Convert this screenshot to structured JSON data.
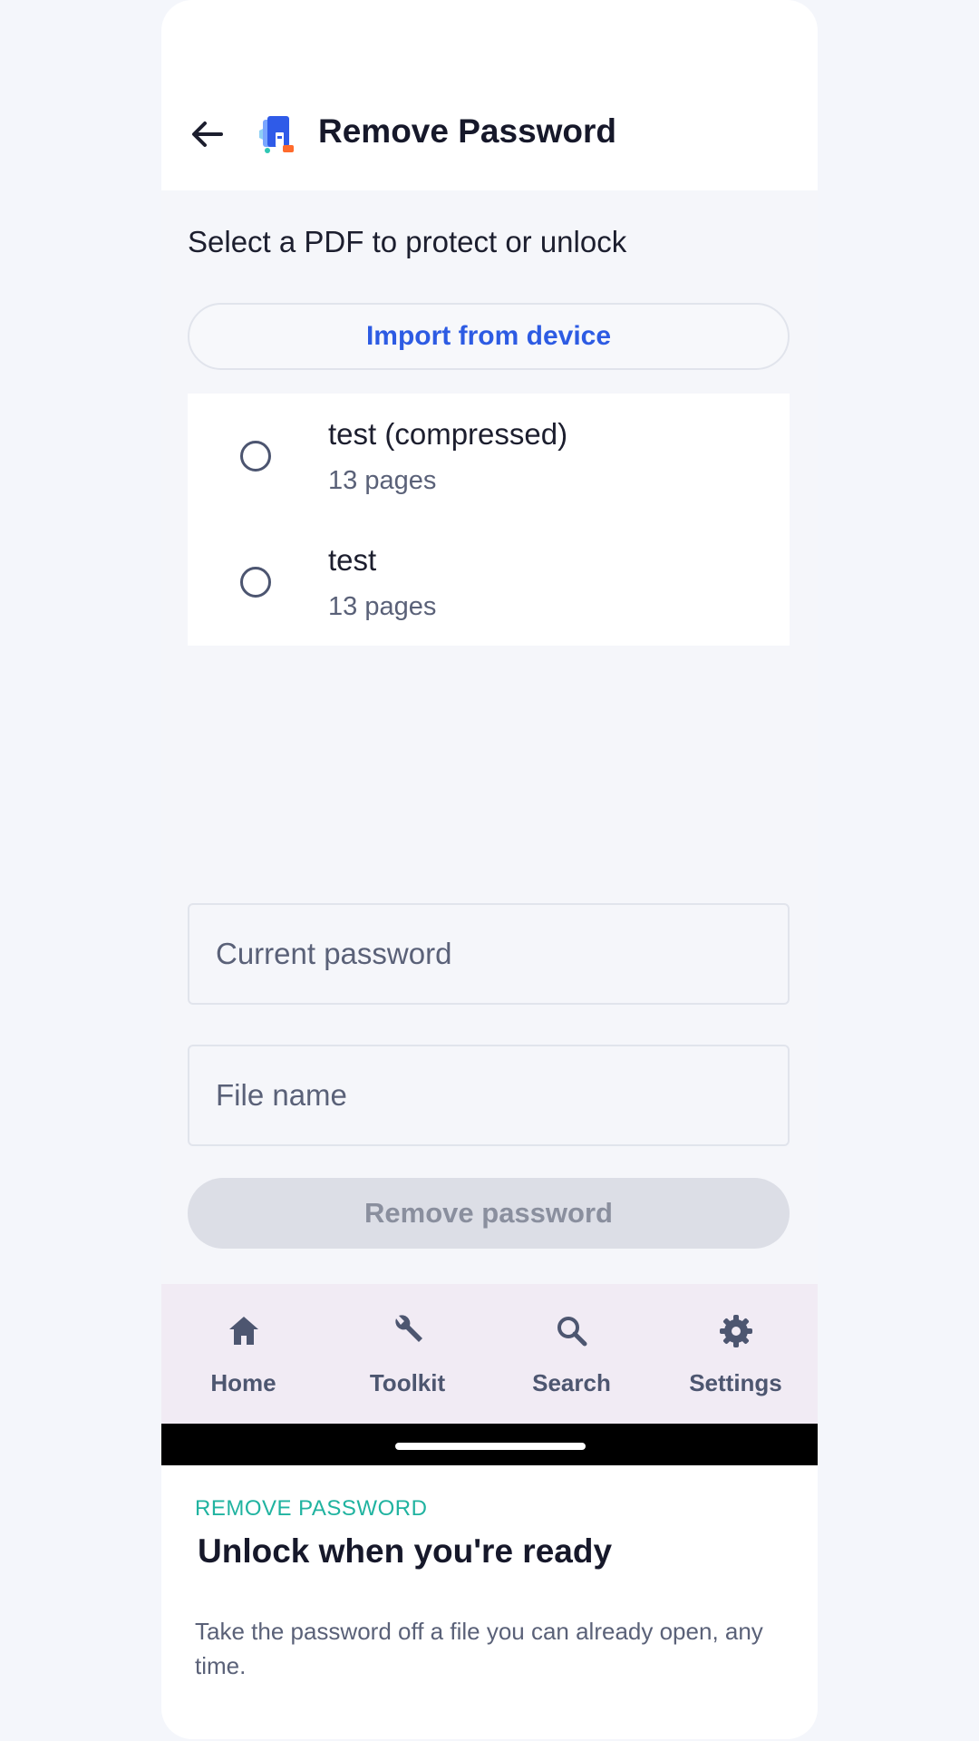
{
  "header": {
    "title": "Remove Password",
    "back_icon": "arrow-left-icon",
    "app_icon": "pdf-tool-app-icon"
  },
  "main": {
    "subtitle": "Select a PDF to protect or unlock",
    "import_button": "Import from device",
    "files": [
      {
        "name": "test (compressed)",
        "pages": "13 pages",
        "selected": false
      },
      {
        "name": "test",
        "pages": "13 pages",
        "selected": false
      }
    ],
    "current_password_placeholder": "Current password",
    "file_name_placeholder": "File name",
    "remove_button": "Remove password"
  },
  "nav": {
    "items": [
      {
        "label": "Home",
        "icon": "home-icon"
      },
      {
        "label": "Toolkit",
        "icon": "wrench-icon"
      },
      {
        "label": "Search",
        "icon": "search-icon"
      },
      {
        "label": "Settings",
        "icon": "gear-icon"
      }
    ]
  },
  "promo": {
    "kicker": "REMOVE PASSWORD",
    "title": "Unlock when you're ready",
    "body": "Take the password off a file you can already open, any time."
  },
  "colors": {
    "accent": "#2d5be3",
    "promo_accent": "#20b3a0",
    "nav_background": "#f1ebf4",
    "disabled_button": "#dcdee6"
  }
}
